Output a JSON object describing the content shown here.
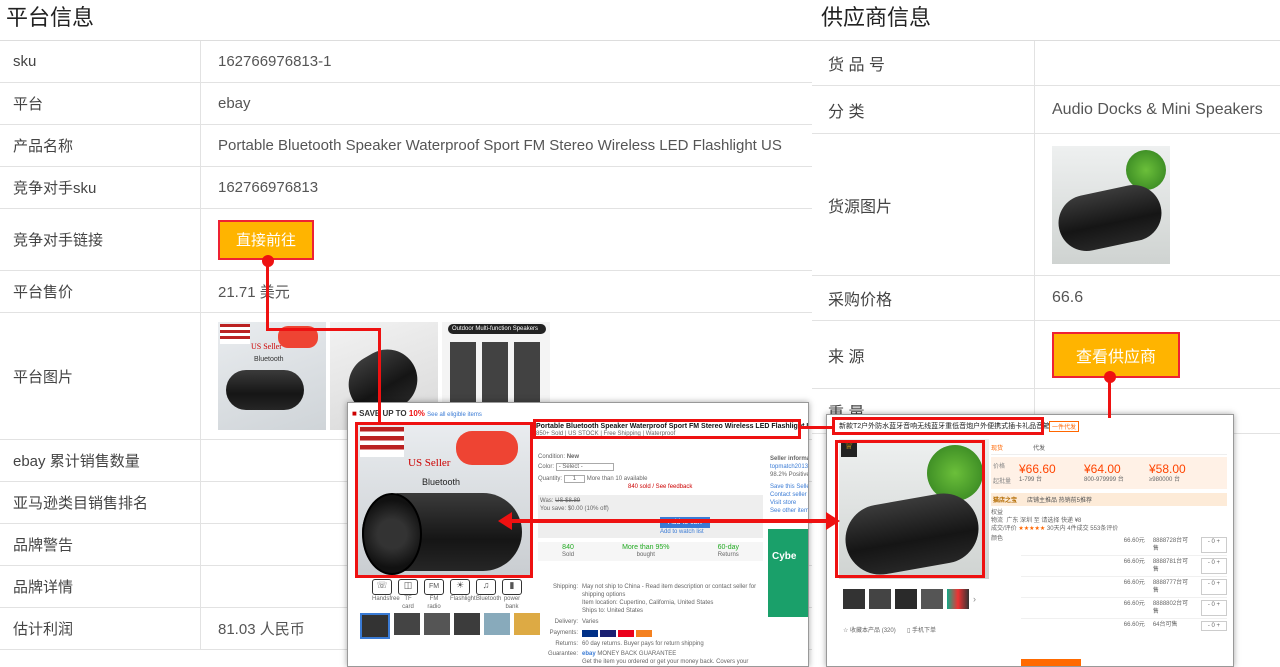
{
  "left_panel": {
    "title": "平台信息",
    "rows": [
      {
        "label": "sku",
        "value": "162766976813-1"
      },
      {
        "label": "平台",
        "value": "ebay"
      },
      {
        "label": "产品名称",
        "value": "Portable Bluetooth Speaker Waterproof Sport FM Stereo Wireless LED Flashlight US"
      },
      {
        "label": "竞争对手sku",
        "value": "162766976813"
      },
      {
        "label": "竞争对手链接",
        "button": "直接前往"
      },
      {
        "label": "平台售价",
        "value": "21.71 美元"
      },
      {
        "label": "平台图片"
      },
      {
        "label": "ebay 累计销售数量",
        "value": ""
      },
      {
        "label": "亚马逊类目销售排名",
        "value": ""
      },
      {
        "label": "品牌警告",
        "value": ""
      },
      {
        "label": "品牌详情",
        "value": ""
      },
      {
        "label": "估计利润",
        "value": "81.03 人民币"
      }
    ],
    "thumb_text": {
      "us_seller": "US Seller",
      "bluetooth": "Bluetooth",
      "outdoor": "Outdoor Multi-function Speakers"
    }
  },
  "right_panel": {
    "title": "供应商信息",
    "rows": [
      {
        "label": "货 品 号",
        "value": ""
      },
      {
        "label": "分 类",
        "value": "Audio Docks & Mini Speakers"
      },
      {
        "label": "货源图片"
      },
      {
        "label": "采购价格",
        "value": "66.6"
      },
      {
        "label": "来 源",
        "button": "查看供应商"
      },
      {
        "label": "重 量",
        "value": ""
      }
    ]
  },
  "ebay_shot": {
    "banner": "SAVE UP TO",
    "banner_pct": "10%",
    "banner_link": "See all eligible items",
    "title": "Portable Bluetooth Speaker Waterproof Sport FM Stereo Wireless LED Flashlight US",
    "subtitle": "850+ Sold | US STOCK | Free Shipping | Waterproof",
    "condition_label": "Condition:",
    "condition_value": "New",
    "color_label": "Color:",
    "color_value": "- Select -",
    "quantity_label": "Quantity:",
    "quantity_value": "1",
    "quantity_note": "More than 10 available",
    "sold_note": "840 sold / See feedback",
    "was_label": "Was:",
    "was_value": "US $8.89",
    "save_label": "You save:",
    "save_value": "$0.00 (10% off)",
    "add_to_cart": "Add to cart",
    "add_watch": "Add to watch list",
    "stats": [
      {
        "value": "840",
        "label": "Sold"
      },
      {
        "value": "More than 95%",
        "label": "bought"
      },
      {
        "value": "60-day",
        "label": "Returns"
      }
    ],
    "seller_info": "Seller information",
    "seller_name": "topmatch2013",
    "seller_positive": "98.2% Positive feedback",
    "seller_links": [
      "Save this Seller",
      "Contact seller",
      "Visit store",
      "See other items"
    ],
    "feature_icons": [
      "Handsfree",
      "TF card",
      "FM radio",
      "Flashlight",
      "Bluetooth",
      "power bank"
    ],
    "shipping_label": "Shipping:",
    "shipping_value": "May not ship to China - Read item description or contact seller for shipping options",
    "location": "Item location: Cupertino, California, United States",
    "ships_to": "Ships to: United States",
    "delivery_label": "Delivery:",
    "delivery_value": "Varies",
    "payments_label": "Payments:",
    "returns_label": "Returns:",
    "returns_value": "60 day returns. Buyer pays for return shipping",
    "guarantee_label": "Guarantee:",
    "guarantee_value": "MONEY BACK GUARANTEE",
    "guarantee_note": "Get the item you ordered or get your money back. Covers your purchase price and original shipping.",
    "promo": "Cybe"
  },
  "supplier_shot": {
    "title": "新款T2户外防水蓝牙音响无线蓝牙重低音炮户外便携式插卡礼品音箱",
    "tag": "一件代发",
    "tabs": [
      "现货",
      "代发"
    ],
    "price_label": "价格",
    "qty_label": "起批量",
    "prices": [
      {
        "price": "¥66.60",
        "qty": "1-799 台"
      },
      {
        "price": "¥64.00",
        "qty": "800-979999 台"
      },
      {
        "price": "¥58.00",
        "qty": "≥980000 台"
      }
    ],
    "store_banner": "猫店之宝",
    "store_links": "店铺主推品 热销前5推荐",
    "perks_label": "权益",
    "ship_label": "物流",
    "ship_value": "广东 深圳 至 请选择 快递 ¥8",
    "rating_label": "成交/评价",
    "rating_value": "30天内 4件成交 553条评价",
    "color_label": "颜色",
    "variants": [
      {
        "price": "66.60元",
        "stock": "8888728台可售"
      },
      {
        "price": "66.60元",
        "stock": "8888781台可售"
      },
      {
        "price": "66.60元",
        "stock": "8888777台可售"
      },
      {
        "price": "66.60元",
        "stock": "8888802台可售"
      },
      {
        "price": "66.60元",
        "stock": "64台可售"
      }
    ],
    "follow": "收藏本产品 (320)",
    "mobile": "手机下单"
  },
  "colors": {
    "accent_orange": "#ffb400",
    "annotation_red": "#e11111",
    "ebay_blue": "#3a7bd5",
    "supplier_orange": "#ff4400"
  }
}
